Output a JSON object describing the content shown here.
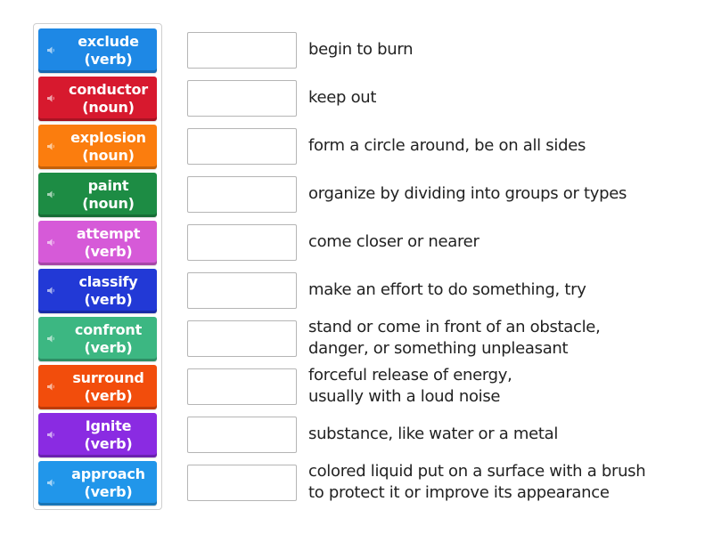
{
  "cards": [
    {
      "word": "exclude",
      "pos": "(verb)",
      "color": "#1e88e5",
      "icon": "speaker-icon"
    },
    {
      "word": "conductor",
      "pos": "(noun)",
      "color": "#d7192e",
      "icon": "speaker-icon"
    },
    {
      "word": "explosion",
      "pos": "(noun)",
      "color": "#fb7d0e",
      "icon": "speaker-icon"
    },
    {
      "word": "paint",
      "pos": "(noun)",
      "color": "#1d8c44",
      "icon": "speaker-icon"
    },
    {
      "word": "attempt",
      "pos": "(verb)",
      "color": "#d65ad8",
      "icon": "speaker-icon"
    },
    {
      "word": "classify",
      "pos": "(verb)",
      "color": "#2239d6",
      "icon": "speaker-icon"
    },
    {
      "word": "confront",
      "pos": "(verb)",
      "color": "#3cb782",
      "icon": "speaker-icon"
    },
    {
      "word": "surround",
      "pos": "(verb)",
      "color": "#f24d0c",
      "icon": "speaker-icon"
    },
    {
      "word": "Ignite",
      "pos": "(verb)",
      "color": "#8a2be2",
      "icon": "speaker-icon"
    },
    {
      "word": "approach",
      "pos": "(verb)",
      "color": "#2196ea",
      "icon": "speaker-icon"
    }
  ],
  "definitions": [
    "begin to burn",
    "keep out",
    "form a circle around, be on all sides",
    "organize by dividing into groups or types",
    "come closer or nearer",
    "make an effort to do something, try",
    "stand or come in front of an obstacle,\ndanger, or something unpleasant",
    "forceful release of energy,\nusually with a loud noise",
    "substance, like water or a metal",
    "colored liquid put on a surface with a brush\nto protect it or improve its appearance"
  ]
}
